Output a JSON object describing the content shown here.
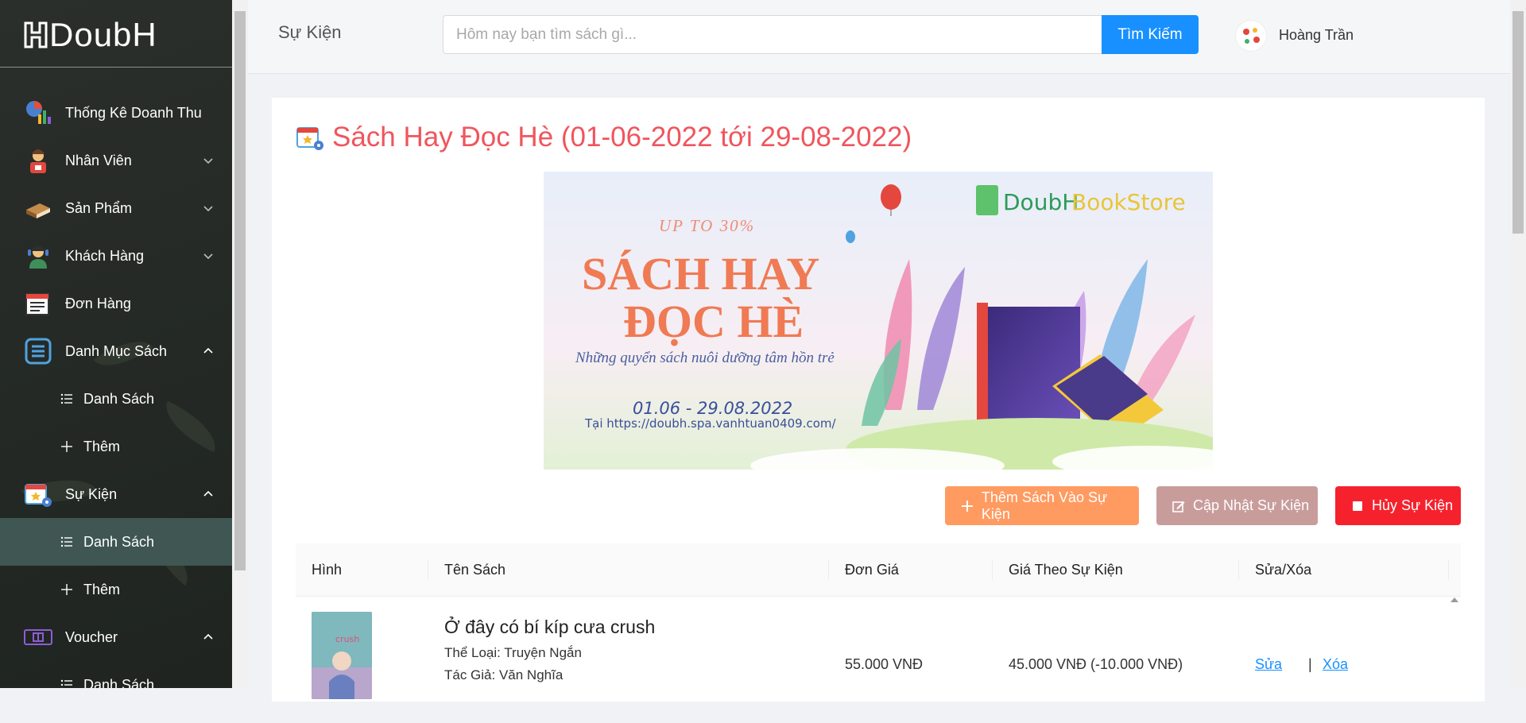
{
  "app": {
    "brand": "DoubH"
  },
  "sidebar": {
    "items": [
      {
        "label": "Thống Kê Doanh Thu",
        "icon": "revenue-chart-icon"
      },
      {
        "label": "Nhân Viên",
        "icon": "employee-icon",
        "expanded": false
      },
      {
        "label": "Sản Phẩm",
        "icon": "books-icon",
        "expanded": false
      },
      {
        "label": "Khách Hàng",
        "icon": "customer-icon",
        "expanded": false
      },
      {
        "label": "Đơn Hàng",
        "icon": "orders-icon"
      },
      {
        "label": "Danh Mục Sách",
        "icon": "list-icon",
        "expanded": true,
        "children": [
          {
            "label": "Danh Sách",
            "icon": "list-bullets-icon"
          },
          {
            "label": "Thêm",
            "icon": "plus-icon"
          }
        ]
      },
      {
        "label": "Sự Kiện",
        "icon": "calendar-event-icon",
        "expanded": true,
        "children": [
          {
            "label": "Danh Sách",
            "icon": "list-bullets-icon",
            "active": true
          },
          {
            "label": "Thêm",
            "icon": "plus-icon"
          }
        ]
      },
      {
        "label": "Voucher",
        "icon": "voucher-icon",
        "expanded": true,
        "children": [
          {
            "label": "Danh Sách",
            "icon": "list-bullets-icon"
          }
        ]
      }
    ]
  },
  "header": {
    "title": "Sự Kiện",
    "search_placeholder": "Hôm nay bạn tìm sách gì...",
    "search_value": "",
    "search_button": "Tìm Kiếm",
    "user_name": "Hoàng Trần"
  },
  "event": {
    "title": "Sách Hay Đọc Hè (01-06-2022 tới 29-08-2022)",
    "banner": {
      "store_name_a": "DoubH",
      "store_name_b": "BookStore",
      "promo": "UP TO 30%",
      "headline_1": "SÁCH HAY",
      "headline_2": "ĐỌC HÈ",
      "tagline": "Những quyển sách nuôi dưỡng tâm hồn trẻ",
      "dates": "01.06 - 29.08.2022",
      "url_line": "Tại https://doubh.spa.vanhtuan0409.com/"
    },
    "actions": {
      "add": "Thêm Sách Vào Sự Kiện",
      "update": "Cập Nhật Sự Kiện",
      "cancel": "Hủy Sự Kiện"
    }
  },
  "table": {
    "columns": [
      "Hình",
      "Tên Sách",
      "Đơn Giá",
      "Giá Theo Sự Kiện",
      "Sửa/Xóa"
    ],
    "rows": [
      {
        "name": "Ở đây có bí kíp cưa crush",
        "genre": "Thể Loại: Truyện Ngắn",
        "author": "Tác Giả: Văn Nghĩa",
        "price": "55.000 VNĐ",
        "event_price": "45.000 VNĐ (-10.000 VNĐ)",
        "cover_text": "crush",
        "edit": "Sửa",
        "sep": "|",
        "delete": "Xóa"
      }
    ]
  },
  "colors": {
    "sidebar_bg": "#262b27",
    "active_item": "#3f5652",
    "primary": "#1890ff",
    "title_red": "#f0555d",
    "btn_add": "#ff9b61",
    "btn_update": "#c99c9c",
    "btn_cancel": "#f5222d"
  }
}
